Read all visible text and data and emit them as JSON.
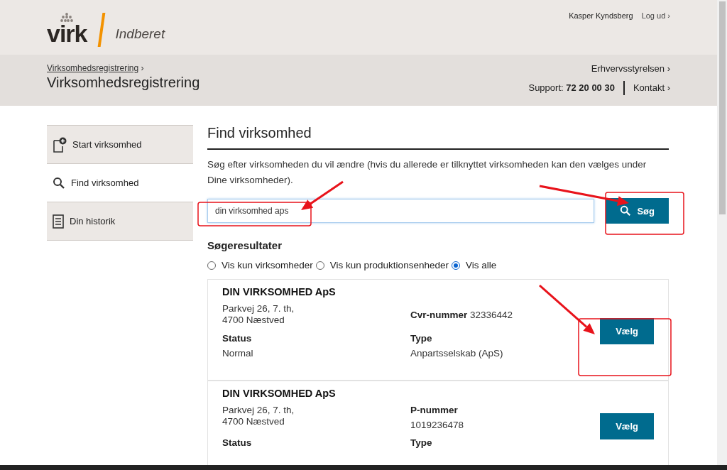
{
  "header": {
    "logo_text": "virk",
    "product": "Indberet",
    "user": "Kasper Kyndsberg",
    "logout": "Log ud ›"
  },
  "subheader": {
    "breadcrumb": "Virksomhedsregistrering",
    "breadcrumb_arrow": "›",
    "title": "Virksomhedsregistrering",
    "agency": "Erhvervsstyrelsen",
    "agency_arrow": "›",
    "support_label": "Support:",
    "support_phone": "72 20 00 30",
    "contact": "Kontakt",
    "contact_arrow": "›"
  },
  "sidebar": {
    "items": [
      {
        "label": "Start virksomhed",
        "kind": "start",
        "selected": false
      },
      {
        "label": "Find virksomhed",
        "kind": "search",
        "selected": true
      },
      {
        "label": "Din historik",
        "kind": "history",
        "selected": false
      }
    ]
  },
  "main": {
    "title": "Find virksomhed",
    "intro": "Søg efter virksomheden du vil ændre (hvis du allerede er tilknyttet virksomheden kan den vælges under Dine virksomheder).",
    "search": {
      "value": "din virksomhed aps",
      "button": "Søg"
    },
    "results_title": "Søgeresultater",
    "filters": [
      {
        "label": "Vis kun virksomheder",
        "selected": false
      },
      {
        "label": "Vis kun produktionsenheder",
        "selected": false
      },
      {
        "label": "Vis alle",
        "selected": true
      }
    ],
    "results": [
      {
        "name": "DIN VIRKSOMHED ApS",
        "address": [
          "Parkvej 26, 7. th,",
          "4700 Næstved"
        ],
        "kind": "inline",
        "id_label": "Cvr-nummer",
        "id_value": "32336442",
        "status_label": "Status",
        "status": "Normal",
        "type_label": "Type",
        "type": "Anpartsselskab (ApS)",
        "button": "Vælg"
      },
      {
        "name": "DIN VIRKSOMHED ApS",
        "address": [
          "Parkvej 26, 7. th,",
          "4700 Næstved"
        ],
        "kind": "stacked",
        "id_label": "P-nummer",
        "id_value": "1019236478",
        "status_label": "Status",
        "type_label": "Type",
        "button": "Vælg"
      }
    ]
  }
}
